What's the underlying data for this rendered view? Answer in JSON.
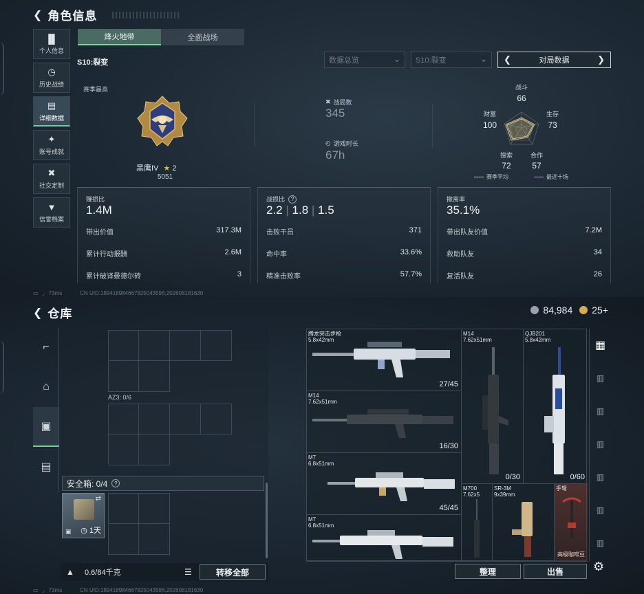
{
  "top": {
    "header": {
      "title": "角色信息"
    },
    "nav": [
      {
        "label": "个人信息",
        "icon": "bar-chart-icon"
      },
      {
        "label": "历史战绩",
        "icon": "history-icon"
      },
      {
        "label": "详细数据",
        "icon": "folder-icon",
        "active": true
      },
      {
        "label": "账号成就",
        "icon": "medal-icon"
      },
      {
        "label": "社交定制",
        "icon": "tools-icon"
      },
      {
        "label": "信誉档案",
        "icon": "shield-icon"
      }
    ],
    "tabs": [
      {
        "label": "烽火地带",
        "active": true
      },
      {
        "label": "全面战场",
        "active": false
      }
    ],
    "season": "S10:裂变",
    "dropdowns": {
      "overview": "数据总览",
      "season": "S10:裂变",
      "match_data": "对局数据"
    },
    "season_best": {
      "label": "赛季最高",
      "rank_name": "黑鹰IV",
      "stars": "2",
      "points": "5051"
    },
    "stats": {
      "matches": {
        "label": "战局数",
        "value": "345"
      },
      "playtime": {
        "label": "游戏时长",
        "value": "67h"
      }
    },
    "radar": {
      "labels": {
        "combat": "战斗",
        "survival": "生存",
        "teamwork": "合作",
        "search": "搜索",
        "wealth": "财富"
      },
      "values": {
        "combat": "66",
        "survival": "73",
        "teamwork": "57",
        "search": "72",
        "wealth": "100"
      },
      "legend": {
        "season_avg": "赛季平均",
        "last_ten": "最近十场"
      },
      "colors": {
        "season_avg": "#c9d0d6",
        "last_ten": "#d8b35a"
      }
    },
    "cards": {
      "profit": {
        "title": "赚损比",
        "big": "1.4M",
        "rows": [
          {
            "label": "带出价值",
            "value": "317.3M"
          },
          {
            "label": "累计行动报酬",
            "value": "2.6M"
          },
          {
            "label": "累计破译曼德尔砖",
            "value": "3"
          }
        ]
      },
      "kd": {
        "title": "战损比",
        "big1": "2.2",
        "big2": "1.8",
        "big3": "1.5",
        "rows": [
          {
            "label": "击败干员",
            "value": "371"
          },
          {
            "label": "命中率",
            "value": "33.6%"
          },
          {
            "label": "精准击败率",
            "value": "57.7%"
          }
        ]
      },
      "extract": {
        "title": "撤离率",
        "big": "35.1%",
        "rows": [
          {
            "label": "带出队友价值",
            "value": "7.2M"
          },
          {
            "label": "救助队友",
            "value": "34"
          },
          {
            "label": "复活队友",
            "value": "26"
          }
        ]
      }
    },
    "status": {
      "ping": "73ms",
      "uid": "CN UID:18941898466782504359б,202608181630"
    }
  },
  "bottom": {
    "header": {
      "title": "仓库"
    },
    "currency": {
      "silver": "84,984",
      "gold": "25+"
    },
    "az_label": "AZ3: 0/6",
    "safe": {
      "label": "安全箱: 0/4",
      "days": "1天"
    },
    "weight": "0.6/84千克",
    "buttons": {
      "transfer_all": "转移全部",
      "sort": "整理",
      "sell": "出售"
    },
    "weapons": [
      {
        "name": "腾龙突击步枪",
        "caliber": "5.8x42mm",
        "ammo": "27/45"
      },
      {
        "name": "M14",
        "caliber": "7.62x51mm",
        "ammo": "16/30"
      },
      {
        "name": "M7",
        "caliber": "6.8x51mm",
        "ammo": "45/45"
      },
      {
        "name": "M7",
        "caliber": "6.8x51mm",
        "ammo": ""
      },
      {
        "name": "M14",
        "caliber": "7.62x51mm",
        "ammo": "0/30"
      },
      {
        "name": "QJB201",
        "caliber": "5.8x42mm",
        "ammo": "0/60"
      },
      {
        "name": "M700",
        "caliber": "7.62x5",
        "ammo": ""
      },
      {
        "name": "SR-3M",
        "caliber": "9x39mm",
        "ammo": ""
      },
      {
        "name": "手弩",
        "caliber": "",
        "ammo": "",
        "tag": "高级咖啡豆"
      }
    ],
    "status": {
      "ping": "73ms",
      "uid": "CN UID:18941898466782504359б,202608181630"
    }
  }
}
